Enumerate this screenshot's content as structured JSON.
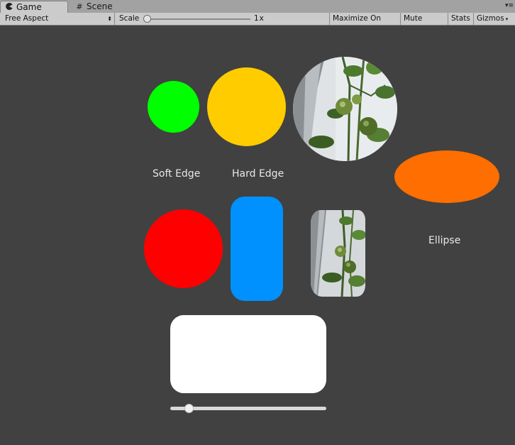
{
  "tabs": [
    {
      "label": "Game",
      "icon": "pacman-icon",
      "active": true
    },
    {
      "label": "Scene",
      "icon": "grid-icon",
      "active": false
    }
  ],
  "toolbar": {
    "aspect": "Free Aspect",
    "scale_label": "Scale",
    "scale_value": "1x",
    "scale_level": 0.0,
    "maximize": "Maximize On Play",
    "mute": "Mute Audio",
    "stats": "Stats",
    "gizmos": "Gizmos"
  },
  "colors": {
    "soft_edge": "#00ff00",
    "hard_edge": "#ffcc00",
    "ellipse": "#ff6e00",
    "red": "#ff0000",
    "pill": "#0091ff",
    "white_panel": "#ffffff",
    "background": "#414141"
  },
  "labels": {
    "soft_edge": "Soft Edge",
    "hard_edge": "Hard Edge",
    "ellipse": "Ellipse"
  },
  "radius_slider": {
    "level": 0.12
  }
}
